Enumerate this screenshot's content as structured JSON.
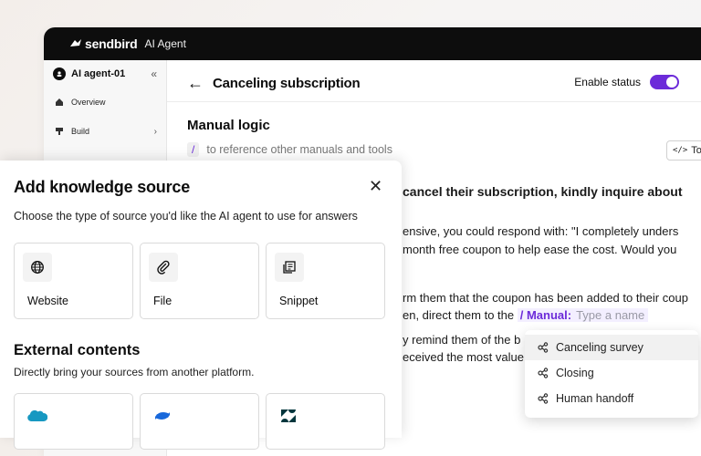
{
  "app": {
    "brand": "sendbird",
    "product": "AI Agent"
  },
  "sidebar": {
    "agent_name": "AI agent-01",
    "collapse_glyph": "«",
    "items": [
      {
        "label": "Overview",
        "icon": "home-icon"
      },
      {
        "label": "Build",
        "icon": "build-icon",
        "has_chevron": true
      }
    ]
  },
  "header": {
    "title": "Canceling subscription",
    "enable_label": "Enable status",
    "enabled": true
  },
  "editor": {
    "section_title": "Manual logic",
    "hint_slash": "/",
    "hint_text": "to reference other manuals and tools",
    "tools_button": "To",
    "lines": [
      "cancel their subscription, kindly inquire about",
      "ensive, you could respond with: \"I completely unders",
      "month free coupon to help ease the cost. Would you",
      "rm them that the coupon has been added to their coup",
      "en, direct them to the ",
      "y remind them of the b",
      "eceived the most value"
    ],
    "manual_tag": "/ Manual:",
    "manual_placeholder": "Type a name"
  },
  "mention_menu": {
    "items": [
      {
        "label": "Canceling survey",
        "active": true
      },
      {
        "label": "Closing",
        "active": false
      },
      {
        "label": "Human handoff",
        "active": false
      }
    ]
  },
  "modal": {
    "title": "Add knowledge source",
    "subtitle": "Choose the type of source you'd like the AI agent to use for answers",
    "sources": [
      {
        "label": "Website",
        "icon": "globe-icon"
      },
      {
        "label": "File",
        "icon": "paperclip-icon"
      },
      {
        "label": "Snippet",
        "icon": "snippet-icon"
      }
    ],
    "external_title": "External contents",
    "external_subtitle": "Directly bring your sources from another platform.",
    "external_sources": [
      {
        "icon": "salesforce-icon",
        "color": "#1798c1"
      },
      {
        "icon": "confluence-icon",
        "color": "#1868db"
      },
      {
        "icon": "zendesk-icon",
        "color": "#03363d"
      }
    ]
  },
  "colors": {
    "accent": "#6c2bd9",
    "topbar": "#0d0d0d"
  }
}
